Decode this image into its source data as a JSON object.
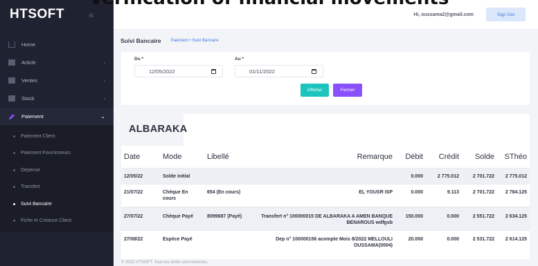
{
  "overlay": {
    "title": "Verification of financial movements"
  },
  "brand": {
    "name": "HTSOFT"
  },
  "sidebar": {
    "items": [
      {
        "label": "Home"
      },
      {
        "label": "Article"
      },
      {
        "label": "Ventes"
      },
      {
        "label": "Stock"
      },
      {
        "label": "Paiement"
      }
    ],
    "sub_items": [
      {
        "label": "Paiement Client"
      },
      {
        "label": "Paiement Fournisseurs"
      },
      {
        "label": "Dépense"
      },
      {
        "label": "Transfert"
      },
      {
        "label": "Suivi Bancaire"
      },
      {
        "label": "Fiche et Créance Client"
      }
    ]
  },
  "topbar": {
    "greeting": "Hi, oussama2@gmail.com",
    "signout": "Sign Out"
  },
  "subheader": {
    "title": "Suivi Bancaire",
    "breadcrumb": "Paiement • Suivi Bancaire"
  },
  "filter": {
    "du_label": "Du *",
    "du_value": "12/05/2022",
    "au_label": "Au *",
    "au_value": "01/11/2022",
    "afficher": "Afficher",
    "fermer": "Fermer"
  },
  "table": {
    "bank": "ALBARAKA",
    "headers": [
      "Date",
      "Mode",
      "Libellé",
      "Remarque",
      "Débit",
      "Crédit",
      "Solde",
      "SThéo"
    ],
    "rows": [
      [
        "12/05/22",
        "Solde initial",
        "",
        "",
        "0.000",
        "2 775.012",
        "2 701.722",
        "2 775.012"
      ],
      [
        "21/07/22",
        "Chèque En cours",
        "654 (En cours)",
        "EL YOUSR ISP",
        "0.000",
        "9.113",
        "2 701.722",
        "2 784.125"
      ],
      [
        "27/07/22",
        "Chèque Payé",
        "8099687 (Payé)",
        "Transfert n° 100000015 DE ALBARAKA A AMEN BANQUE BENAROUS wdfgvb",
        "150.000",
        "0.000",
        "2 551.722",
        "2 634.125"
      ],
      [
        "27/08/22",
        "Espèce Payé",
        "",
        "Dep n° 100000156 acompte Mois 8/2022 MELLOULI OUSSAMA(0004)",
        "20.000",
        "0.000",
        "2 531.722",
        "2 614.125"
      ]
    ]
  },
  "footer": {
    "text": "© 2022 HTSOFT. Tous les droits sont réservés."
  }
}
